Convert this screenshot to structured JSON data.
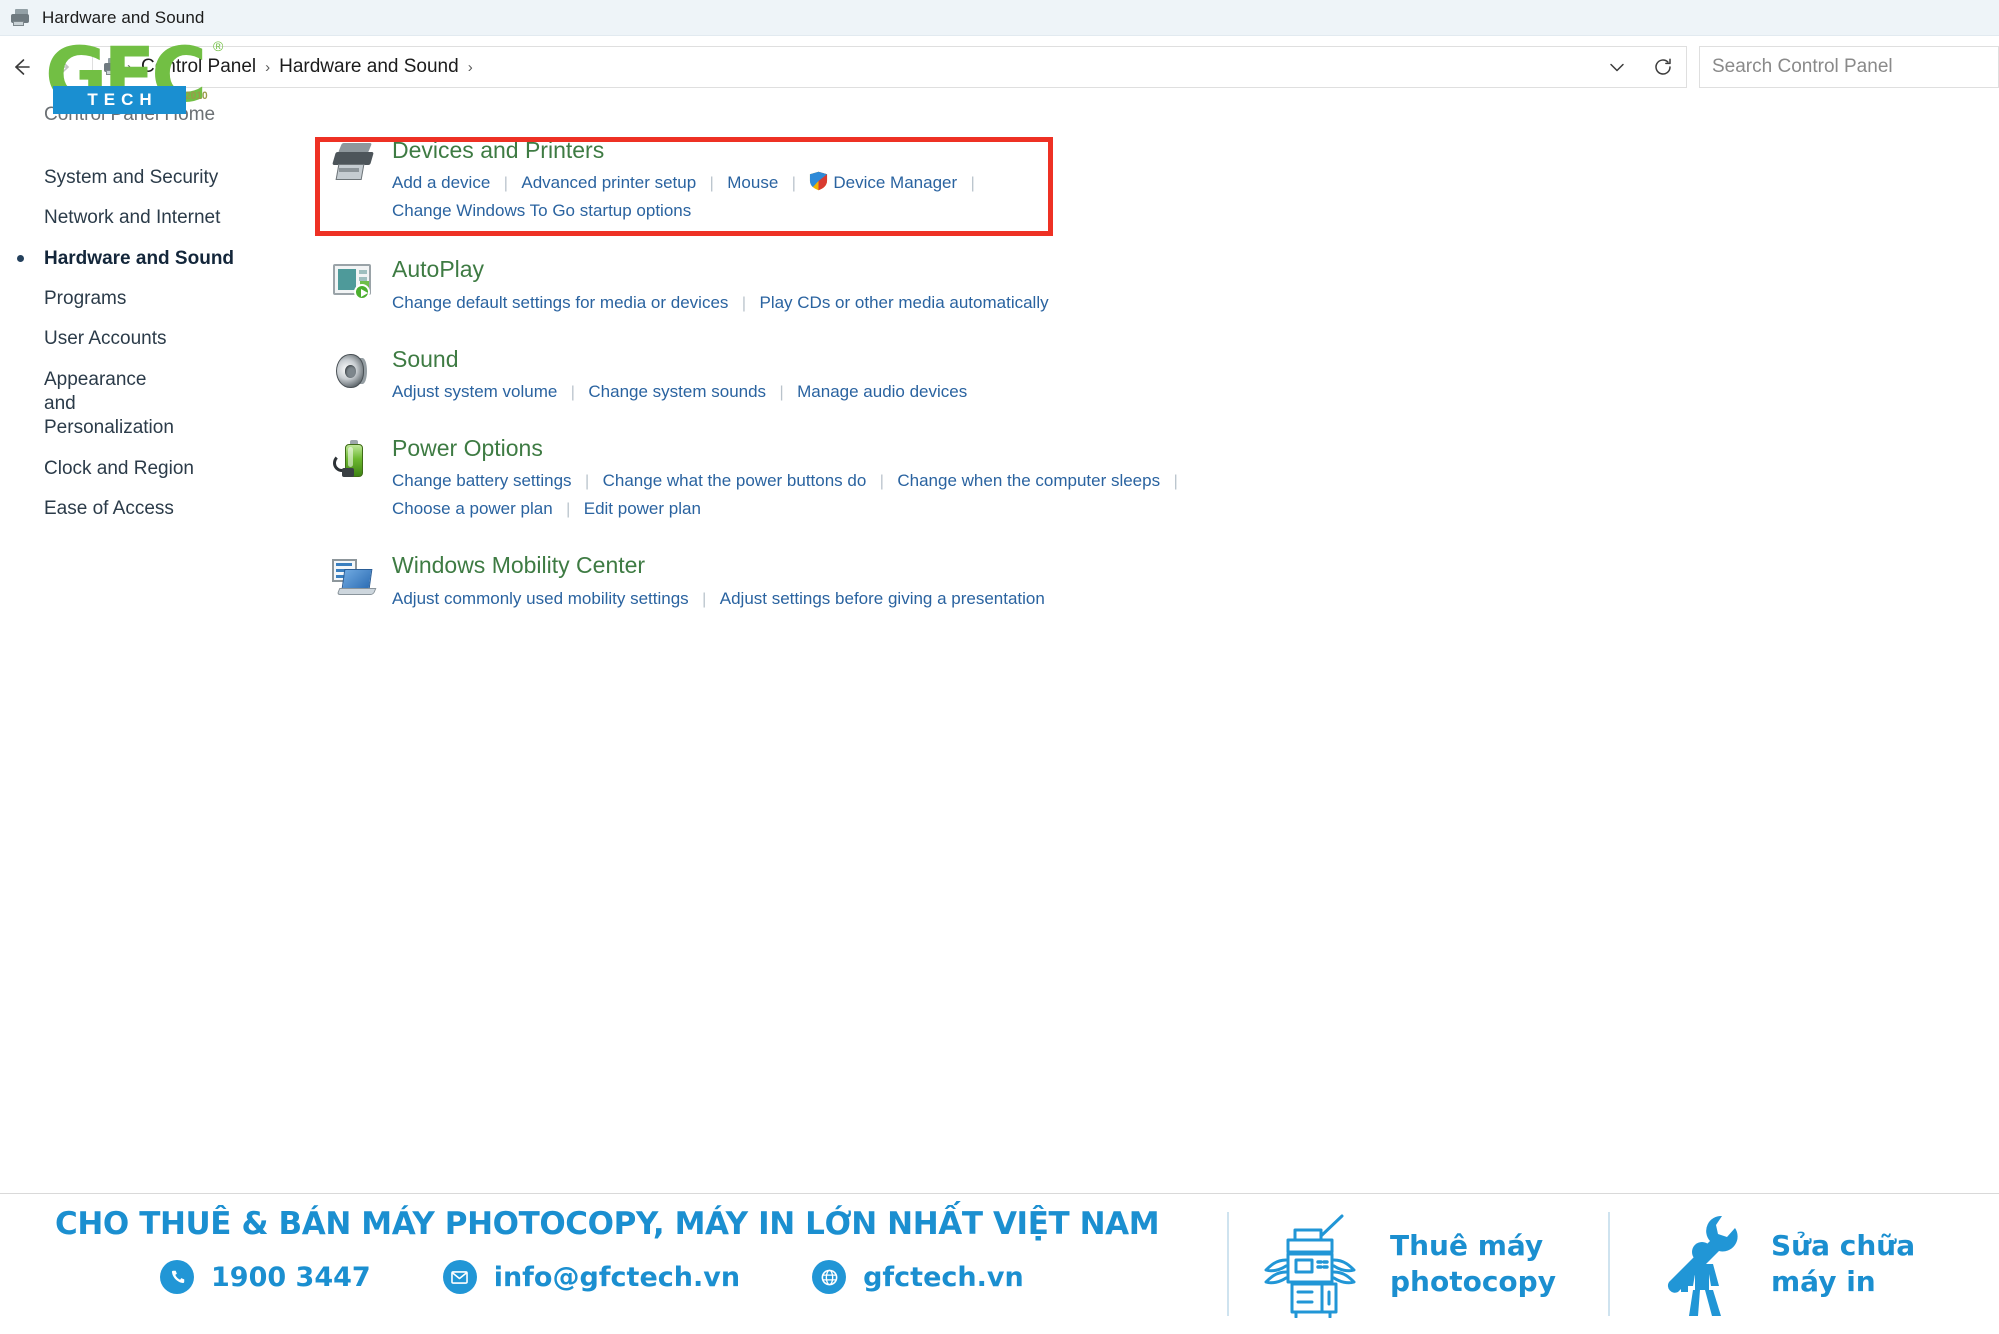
{
  "window": {
    "title": "Hardware and Sound",
    "title_icon": "printer-icon"
  },
  "addressbar": {
    "back_icon": "back-arrow-icon",
    "forward_icon": "forward-arrow-icon",
    "up_icon": "up-arrow-icon",
    "path_icon": "printer-icon",
    "breadcrumbs": [
      "Control Panel",
      "Hardware and Sound"
    ],
    "chevron": "›",
    "dropdown_icon": "chevron-down-icon",
    "refresh_icon": "refresh-icon",
    "search_placeholder": "Search Control Panel"
  },
  "sidebar": {
    "home_label": "Control Panel Home",
    "items": [
      {
        "label": "System and Security",
        "current": false
      },
      {
        "label": "Network and Internet",
        "current": false
      },
      {
        "label": "Hardware and Sound",
        "current": true
      },
      {
        "label": "Programs",
        "current": false
      },
      {
        "label": "User Accounts",
        "current": false
      },
      {
        "label": "Appearance and Personalization",
        "current": false
      },
      {
        "label": "Clock and Region",
        "current": false
      },
      {
        "label": "Ease of Access",
        "current": false
      }
    ]
  },
  "watermark": {
    "gfc": "GFC",
    "registered": "®",
    "since": "Since 2010",
    "tech": "TECH"
  },
  "highlight": {
    "color": "#ee3124",
    "target": "Devices and Printers"
  },
  "categories": [
    {
      "title": "Devices and Printers",
      "icon": "printer-icon",
      "highlighted": true,
      "rows": [
        [
          {
            "label": "Add a device",
            "shield": false
          },
          {
            "label": "Advanced printer setup",
            "shield": false
          },
          {
            "label": "Mouse",
            "shield": false
          },
          {
            "label": "Device Manager",
            "shield": true
          }
        ],
        [
          {
            "label": "Change Windows To Go startup options",
            "shield": false
          }
        ]
      ],
      "trailing_separator": true
    },
    {
      "title": "AutoPlay",
      "icon": "autoplay-icon",
      "highlighted": false,
      "rows": [
        [
          {
            "label": "Change default settings for media or devices",
            "shield": false
          },
          {
            "label": "Play CDs or other media automatically",
            "shield": false
          }
        ]
      ],
      "trailing_separator": false
    },
    {
      "title": "Sound",
      "icon": "speaker-icon",
      "highlighted": false,
      "rows": [
        [
          {
            "label": "Adjust system volume",
            "shield": false
          },
          {
            "label": "Change system sounds",
            "shield": false
          },
          {
            "label": "Manage audio devices",
            "shield": false
          }
        ]
      ],
      "trailing_separator": false
    },
    {
      "title": "Power Options",
      "icon": "battery-icon",
      "highlighted": false,
      "rows": [
        [
          {
            "label": "Change battery settings",
            "shield": false
          },
          {
            "label": "Change what the power buttons do",
            "shield": false
          },
          {
            "label": "Change when the computer sleeps",
            "shield": false
          }
        ],
        [
          {
            "label": "Choose a power plan",
            "shield": false
          },
          {
            "label": "Edit power plan",
            "shield": false
          }
        ]
      ],
      "trailing_separator": true
    },
    {
      "title": "Windows Mobility Center",
      "icon": "mobility-center-icon",
      "highlighted": false,
      "rows": [
        [
          {
            "label": "Adjust commonly used mobility settings",
            "shield": false
          },
          {
            "label": "Adjust settings before giving a presentation",
            "shield": false
          }
        ]
      ],
      "trailing_separator": false
    }
  ],
  "banner": {
    "headline": "CHO THUÊ & BÁN MÁY PHOTOCOPY, MÁY IN LỚN NHẤT VIỆT NAM",
    "accent_color": "#1b8fd0",
    "contacts": [
      {
        "icon": "phone-icon",
        "text": "1900 3447"
      },
      {
        "icon": "mail-icon",
        "text": "info@gfctech.vn"
      },
      {
        "icon": "globe-icon",
        "text": "gfctech.vn"
      }
    ],
    "services": [
      {
        "icon": "copier-icon",
        "line1": "Thuê máy",
        "line2": "photocopy"
      },
      {
        "icon": "repair-worker-icon",
        "line1": "Sửa chữa",
        "line2": "máy in"
      }
    ]
  }
}
